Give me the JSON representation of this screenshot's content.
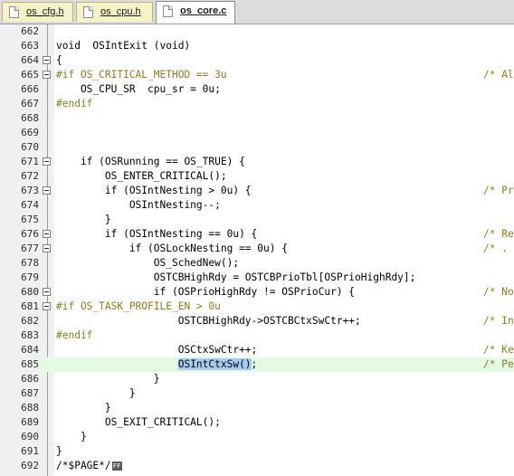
{
  "tabs": [
    {
      "label": "os_cfg.h",
      "active": false
    },
    {
      "label": "os_cpu.h",
      "active": false
    },
    {
      "label": "os_core.c",
      "active": true
    }
  ],
  "editor": {
    "lines": [
      {
        "num": "662",
        "code": "",
        "comment": "",
        "fold": false
      },
      {
        "num": "663",
        "code": "void  OSIntExit (void)",
        "comment": "",
        "fold": false
      },
      {
        "num": "664",
        "code": "{",
        "comment": "",
        "fold": true
      },
      {
        "num": "665",
        "code": "#if OS_CRITICAL_METHOD == 3u",
        "comment": "/* Al",
        "fold": true
      },
      {
        "num": "666",
        "code": "    OS_CPU_SR  cpu_sr = 0u;",
        "comment": "",
        "fold": false
      },
      {
        "num": "667",
        "code": "#endif",
        "comment": "",
        "fold": false
      },
      {
        "num": "668",
        "code": "",
        "comment": "",
        "fold": false
      },
      {
        "num": "669",
        "code": "",
        "comment": "",
        "fold": false
      },
      {
        "num": "670",
        "code": "",
        "comment": "",
        "fold": false
      },
      {
        "num": "671",
        "code": "    if (OSRunning == OS_TRUE) {",
        "comment": "",
        "fold": true
      },
      {
        "num": "672",
        "code": "        OS_ENTER_CRITICAL();",
        "comment": "",
        "fold": false
      },
      {
        "num": "673",
        "code": "        if (OSIntNesting > 0u) {",
        "comment": "/* Pr",
        "fold": true
      },
      {
        "num": "674",
        "code": "            OSIntNesting--;",
        "comment": "",
        "fold": false
      },
      {
        "num": "675",
        "code": "        }",
        "comment": "",
        "fold": false
      },
      {
        "num": "676",
        "code": "        if (OSIntNesting == 0u) {",
        "comment": "/* Re",
        "fold": true
      },
      {
        "num": "677",
        "code": "            if (OSLockNesting == 0u) {",
        "comment": "/* .",
        "fold": true
      },
      {
        "num": "678",
        "code": "                OS_SchedNew();",
        "comment": "",
        "fold": false
      },
      {
        "num": "679",
        "code": "                OSTCBHighRdy = OSTCBPrioTbl[OSPrioHighRdy];",
        "comment": "",
        "fold": false
      },
      {
        "num": "680",
        "code": "                if (OSPrioHighRdy != OSPrioCur) {",
        "comment": "/* No",
        "fold": true
      },
      {
        "num": "681",
        "code": "#if OS_TASK_PROFILE_EN > 0u",
        "comment": "",
        "fold": true
      },
      {
        "num": "682",
        "code": "                    OSTCBHighRdy->OSTCBCtxSwCtr++;",
        "comment": "/* In",
        "fold": false
      },
      {
        "num": "683",
        "code": "#endif",
        "comment": "",
        "fold": false
      },
      {
        "num": "684",
        "code": "                    OSCtxSwCtr++;",
        "comment": "/* Ke",
        "fold": false
      },
      {
        "num": "685",
        "code": "OSIntCtxSw()",
        "code_prefix": "                    ",
        "code_suffix": ";",
        "comment": "/* Pe",
        "fold": false,
        "highlighted": true
      },
      {
        "num": "686",
        "code": "                }",
        "comment": "",
        "fold": false
      },
      {
        "num": "687",
        "code": "            }",
        "comment": "",
        "fold": false
      },
      {
        "num": "688",
        "code": "        }",
        "comment": "",
        "fold": false
      },
      {
        "num": "689",
        "code": "        OS_EXIT_CRITICAL();",
        "comment": "",
        "fold": false
      },
      {
        "num": "690",
        "code": "    }",
        "comment": "",
        "fold": false
      },
      {
        "num": "691",
        "code": "}",
        "comment": "",
        "fold": false
      },
      {
        "num": "692",
        "code": "/*$PAGE*/",
        "comment": "",
        "fold": false,
        "page_icon": "FF"
      }
    ]
  }
}
